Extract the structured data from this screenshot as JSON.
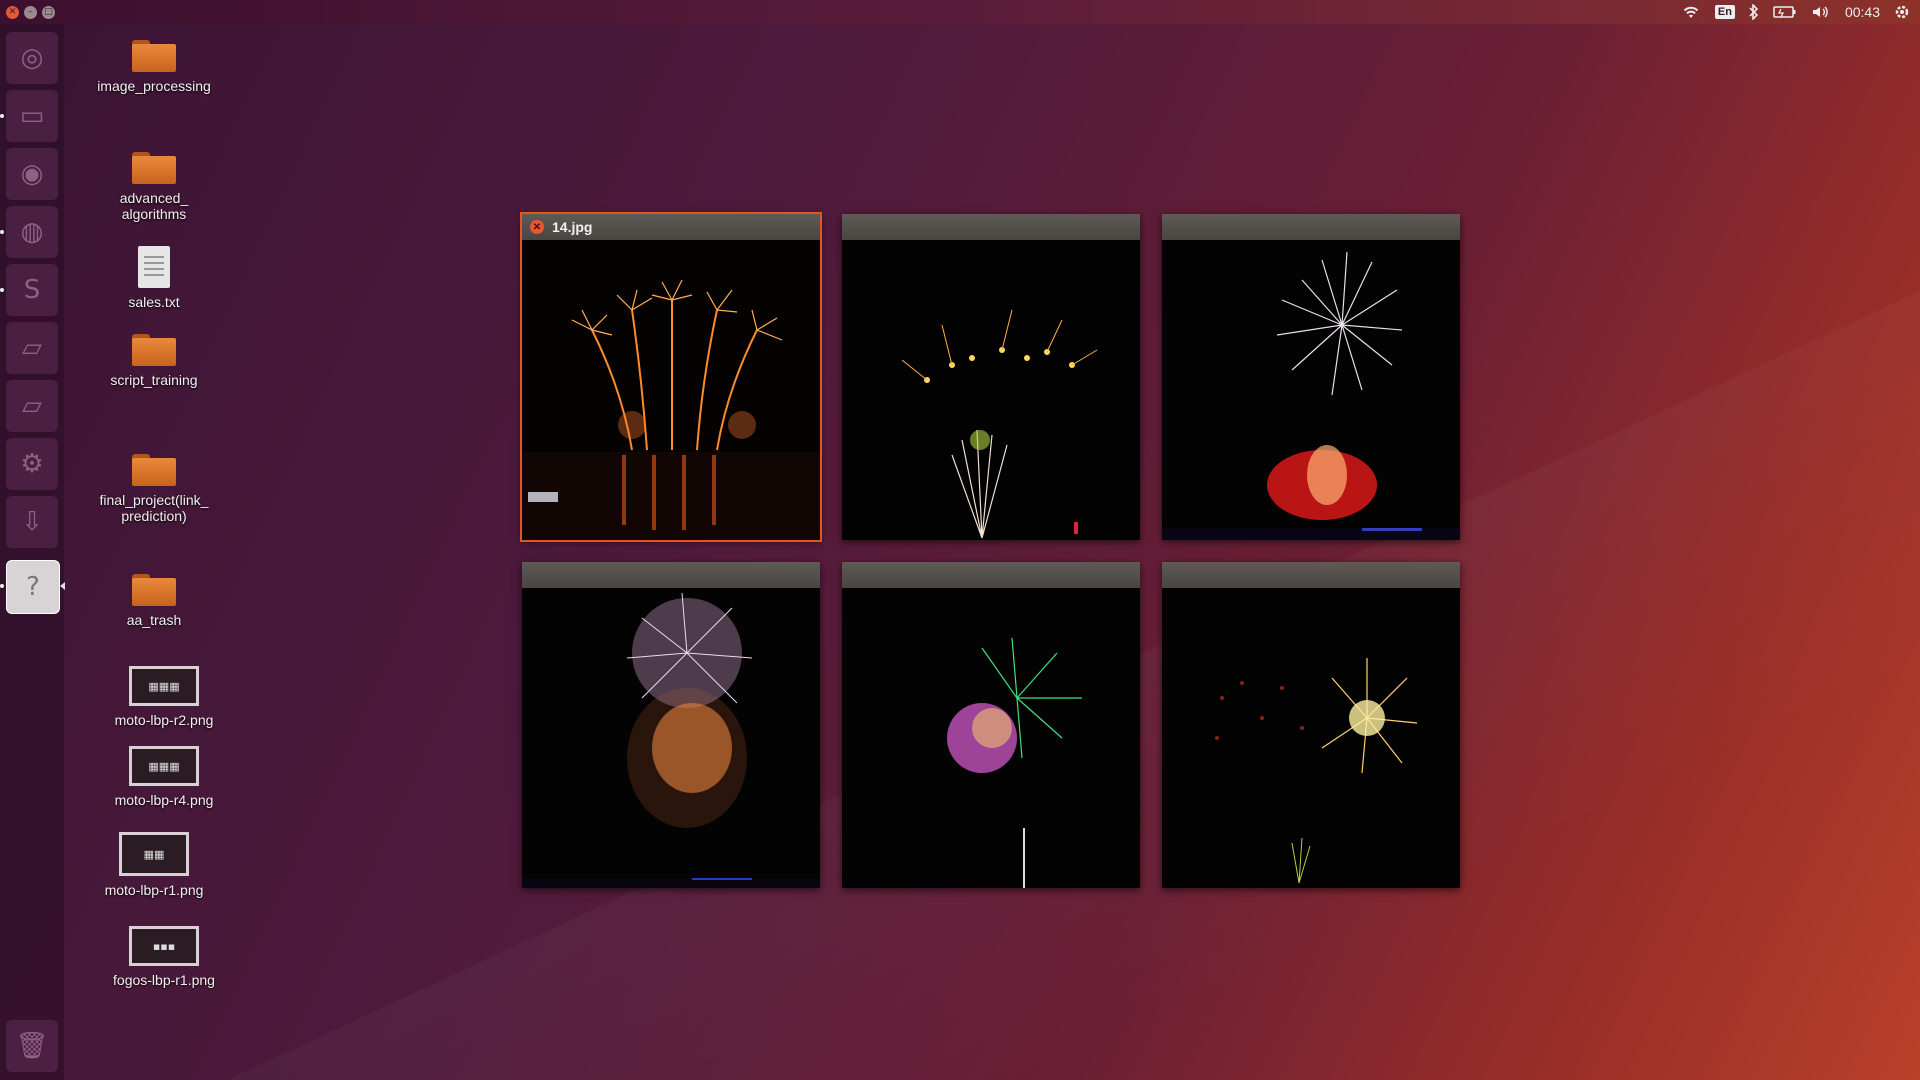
{
  "topbar": {
    "clock": "00:43",
    "keyboard_layout": "En",
    "icons": [
      "wifi-icon",
      "keyboard-layout-icon",
      "bluetooth-icon",
      "battery-icon",
      "volume-icon",
      "clock",
      "session-gear-icon"
    ]
  },
  "launcher": {
    "items": [
      {
        "name": "dash-home",
        "glyph": "◎"
      },
      {
        "name": "files",
        "glyph": "▭"
      },
      {
        "name": "chromium",
        "glyph": "◉"
      },
      {
        "name": "firefox",
        "glyph": "◍"
      },
      {
        "name": "sublime-text",
        "glyph": "S"
      },
      {
        "name": "drive-1",
        "glyph": "▱"
      },
      {
        "name": "drive-2",
        "glyph": "▱"
      },
      {
        "name": "settings",
        "glyph": "⚙"
      },
      {
        "name": "downloads",
        "glyph": "⇩"
      },
      {
        "name": "help",
        "glyph": "?"
      },
      {
        "name": "trash",
        "glyph": "🗑"
      }
    ]
  },
  "desktop": {
    "icons": [
      {
        "label": "image_processing",
        "type": "folder"
      },
      {
        "label": "advanced_\nalgorithms",
        "type": "folder"
      },
      {
        "label": "sales.txt",
        "type": "text"
      },
      {
        "label": "script_training",
        "type": "folder"
      },
      {
        "label": "final_project(link_\nprediction)",
        "type": "folder"
      },
      {
        "label": "aa_trash",
        "type": "folder"
      },
      {
        "label": "moto-lbp-r2.png",
        "type": "image"
      },
      {
        "label": "moto-lbp-r4.png",
        "type": "image"
      },
      {
        "label": "moto-lbp-r1.png",
        "type": "image"
      },
      {
        "label": "fogos-lbp-r1.png",
        "type": "image"
      }
    ]
  },
  "spread": {
    "windows": [
      {
        "title": "14.jpg",
        "active": true
      },
      {
        "title": "",
        "active": false
      },
      {
        "title": "",
        "active": false
      },
      {
        "title": "",
        "active": false
      },
      {
        "title": "",
        "active": false
      },
      {
        "title": "",
        "active": false
      }
    ]
  },
  "colors": {
    "accent": "#e8572f",
    "folder": "#e98a3b"
  }
}
